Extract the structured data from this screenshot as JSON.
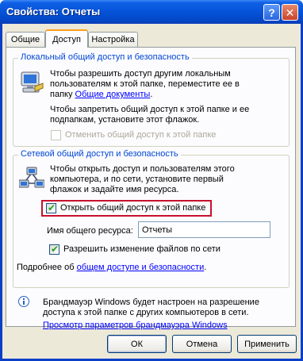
{
  "window": {
    "title": "Свойства: Отчеты",
    "help_glyph": "?",
    "close_glyph": "✕"
  },
  "tabs": [
    {
      "label": "Общие"
    },
    {
      "label": "Доступ",
      "active": true
    },
    {
      "label": "Настройка"
    }
  ],
  "local": {
    "legend": "Локальный общий доступ и безопасность",
    "line1": "Чтобы разрешить доступ другим локальным",
    "line2": "пользователям к этой папке, переместите ее в",
    "line3_prefix": "папку ",
    "line3_link": "Общие документы",
    "line3_suffix": ".",
    "line4": "Чтобы запретить общий доступ к этой папке и ее",
    "line5": "подпапкам, установите этот флажок.",
    "checkbox_label": "Отменить общий доступ к этой папке",
    "checkbox_checked": false,
    "checkbox_enabled": false
  },
  "network": {
    "legend": "Сетевой общий доступ и безопасность",
    "line1": "Чтобы открыть доступ и пользователям этого",
    "line2": "компьютера, и по сети, установите первый",
    "line3": "флажок и задайте имя ресурса.",
    "share_checkbox_label": "Открыть общий доступ к этой папке",
    "share_checked": true,
    "share_name_label": "Имя общего ресурса:",
    "share_name_value": "Отчеты",
    "allow_change_label": "Разрешить изменение файлов по сети",
    "allow_change_checked": true,
    "more_prefix": "Подробнее об ",
    "more_link": "общем доступе и безопасности",
    "more_suffix": "."
  },
  "firewall": {
    "line1": "Брандмауэр Windows будет настроен на разрешение",
    "line2": "доступа к этой папке с других компьютеров в сети.",
    "link": "Просмотр параметров брандмауэра Windows"
  },
  "buttons": {
    "ok": "ОК",
    "cancel": "Отмена",
    "apply": "Применить"
  },
  "colors": {
    "titlebar": "#0553d8",
    "legend": "#0046d5",
    "link": "#0000ff",
    "highlight_border": "#c8102e",
    "check_mark": "#21a121"
  }
}
